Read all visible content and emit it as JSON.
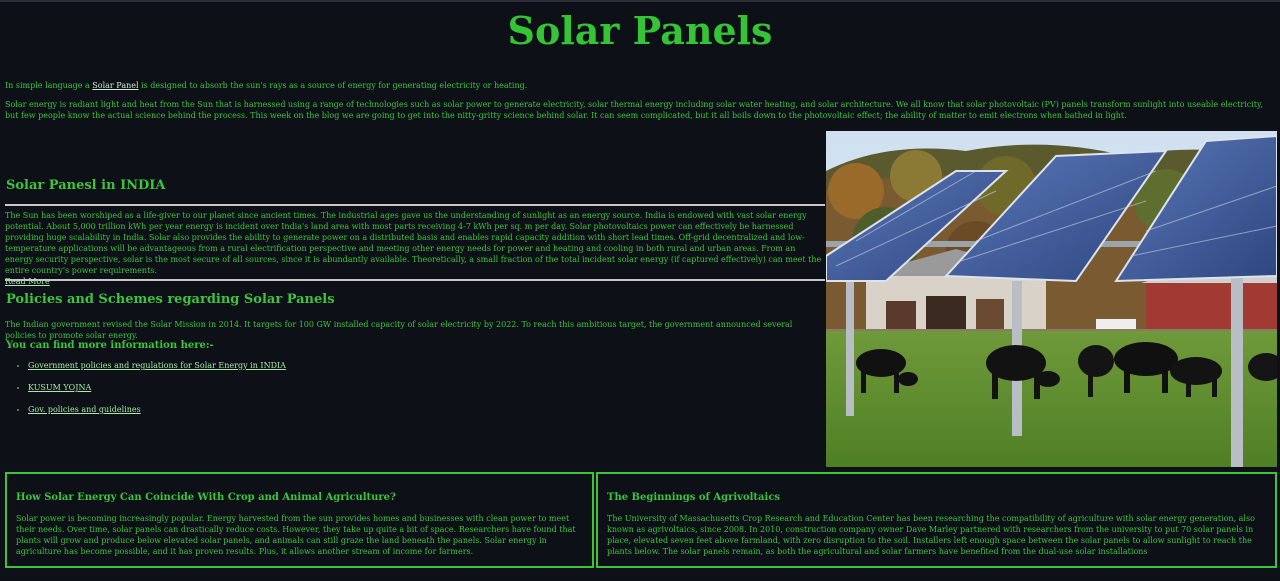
{
  "page_title": "Solar Panels",
  "intro": {
    "line_prefix": "In simple language a ",
    "line_link": "Solar Panel",
    "line_suffix": " is designed to absorb the sun's rays as a source of energy for generating electricity or heating.",
    "paragraph": "Solar energy is radiant light and heat from the Sun that is harnessed using a range of technologies such as solar power to generate electricity, solar thermal energy including solar water heating, and solar architecture. We all know that solar photovoltaic (PV) panels transform sunlight into useable electricity, but few people know the actual science behind the process. This week on the blog we are going to get into the nitty-gritty science behind solar. It can seem complicated, but it all boils down to the photovoltaic effect; the ability of matter to emit electrons when bathed in light."
  },
  "india": {
    "heading": "Solar Panesl in INDIA",
    "text": "The Sun has been worshiped as a life-giver to our planet since ancient times. The industrial ages gave us the understanding of sunlight as an energy source. India is endowed with vast solar energy potential. About 5,000 trillion kWh per year energy is incident over India's land area with most parts receiving 4-7 kWh per sq. m per day. Solar photovoltaics power can effectively be harnessed providing huge scalability in India. Solar also provides the ability to generate power on a distributed basis and enables rapid capacity addition with short lead times. Off-grid decentralized and low-temperature applications will be advantageous from a rural electrification perspective and meeting other energy needs for power and heating and cooling in both rural and urban areas. From an energy security perspective, solar is the most secure of all sources, since it is abundantly available. Theoretically, a small fraction of the total incident solar energy (if captured effectively) can meet the entire country's power requirements.",
    "read_more": "Read More"
  },
  "policies": {
    "heading": "Policies and Schemes regarding Solar Panels",
    "text": "The Indian government revised the Solar Mission in 2014. It targets for 100 GW installed capacity of solar electricity by 2022. To reach this ambitious target, the government announced several policies to promote solar energy.",
    "more_heading": "You can find more information here:-",
    "links": [
      "Government policies and regulations for Solar Energy in INDIA",
      "KUSUM YOJNA",
      "Gov. policies and guidelines"
    ]
  },
  "boxes": [
    {
      "heading": "How Solar Energy Can Coincide With Crop and Animal Agriculture?",
      "text": "Solar power is becoming increasingly popular. Energy harvested from the sun provides homes and businesses with clean power to meet their needs. Over time, solar panels can drastically reduce costs. However, they take up quite a bit of space. Researchers have found that plants will grow and produce below elevated solar panels, and animals can still graze the land beneath the panels. Solar energy in agriculture has become possible, and it has proven results. Plus, it allows another stream of income for farmers."
    },
    {
      "heading": "The Beginnings of Agrivoltaics",
      "text": "The University of Massachusetts Crop Research and Education Center has been researching the compatibility of agriculture with solar energy generation, also known as agrivoltaics, since 2008. In 2010, construction company owner Dave Marley partnered with researchers from the university to put 70 solar panels in place, elevated seven feet above farmland, with zero disruption to the soil. Installers left enough space between the solar panels to allow sunlight to reach the plants below. The solar panels remain, as both the agricultural and solar farmers have benefited from the dual-use solar installations"
    }
  ],
  "colors": {
    "background": "#0d1117",
    "accent_green": "#3cc43c",
    "link_light": "#a8e8a8",
    "rule": "#c8c8c8"
  }
}
